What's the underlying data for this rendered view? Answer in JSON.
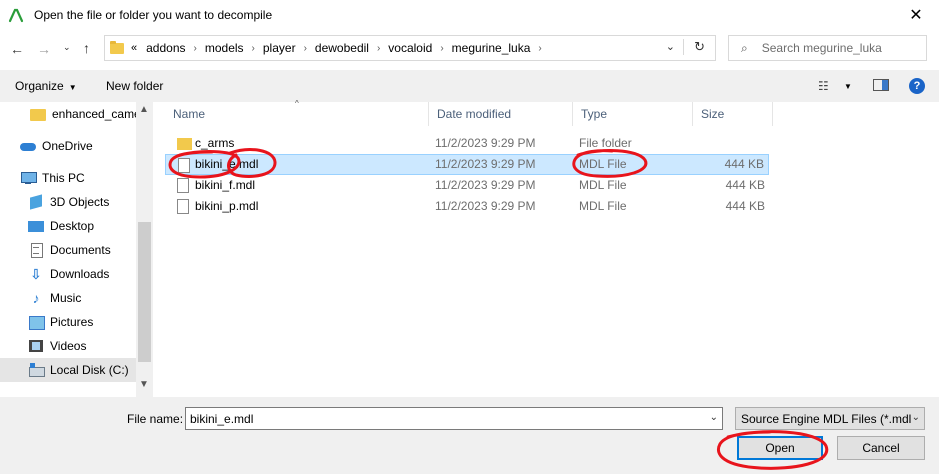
{
  "window": {
    "title": "Open the file or folder you want to decompile",
    "app_icon": "app-logo-icon",
    "close_glyph": "✕"
  },
  "address_bar": {
    "overflow": "«",
    "breadcrumbs": [
      "addons",
      "models",
      "player",
      "dewobedil",
      "vocaloid",
      "megurine_luka"
    ],
    "search_placeholder": "Search megurine_luka"
  },
  "toolbar": {
    "organize_label": "Organize",
    "new_folder_label": "New folder",
    "help_label": "?"
  },
  "nav_pane": {
    "items": [
      {
        "label": "enhanced_came",
        "icon": "folder-icon"
      },
      {
        "label": "OneDrive",
        "icon": "cloud-icon"
      },
      {
        "label": "This PC",
        "icon": "computer-icon"
      },
      {
        "label": "3D Objects",
        "icon": "cube-icon"
      },
      {
        "label": "Desktop",
        "icon": "desktop-icon"
      },
      {
        "label": "Documents",
        "icon": "documents-icon"
      },
      {
        "label": "Downloads",
        "icon": "download-icon"
      },
      {
        "label": "Music",
        "icon": "music-icon"
      },
      {
        "label": "Pictures",
        "icon": "pictures-icon"
      },
      {
        "label": "Videos",
        "icon": "videos-icon"
      },
      {
        "label": "Local Disk (C:)",
        "icon": "disk-icon",
        "selected": true
      }
    ]
  },
  "file_list": {
    "columns": [
      "Name",
      "Date modified",
      "Type",
      "Size"
    ],
    "rows": [
      {
        "name": "c_arms",
        "date": "11/2/2023 9:29 PM",
        "type": "File folder",
        "size": "",
        "kind": "folder"
      },
      {
        "name": "bikini_e.mdl",
        "date": "11/2/2023 9:29 PM",
        "type": "MDL File",
        "size": "444 KB",
        "kind": "file",
        "selected": true
      },
      {
        "name": "bikini_f.mdl",
        "date": "11/2/2023 9:29 PM",
        "type": "MDL File",
        "size": "444 KB",
        "kind": "file"
      },
      {
        "name": "bikini_p.mdl",
        "date": "11/2/2023 9:29 PM",
        "type": "MDL File",
        "size": "444 KB",
        "kind": "file"
      }
    ]
  },
  "footer": {
    "file_name_label": "File name:",
    "file_name_value": "bikini_e.mdl",
    "file_type": "Source Engine MDL Files (*.mdl",
    "open_label": "Open",
    "cancel_label": "Cancel"
  },
  "colors": {
    "selection_fill": "#cce8ff",
    "annotation_red": "#e8141c"
  }
}
